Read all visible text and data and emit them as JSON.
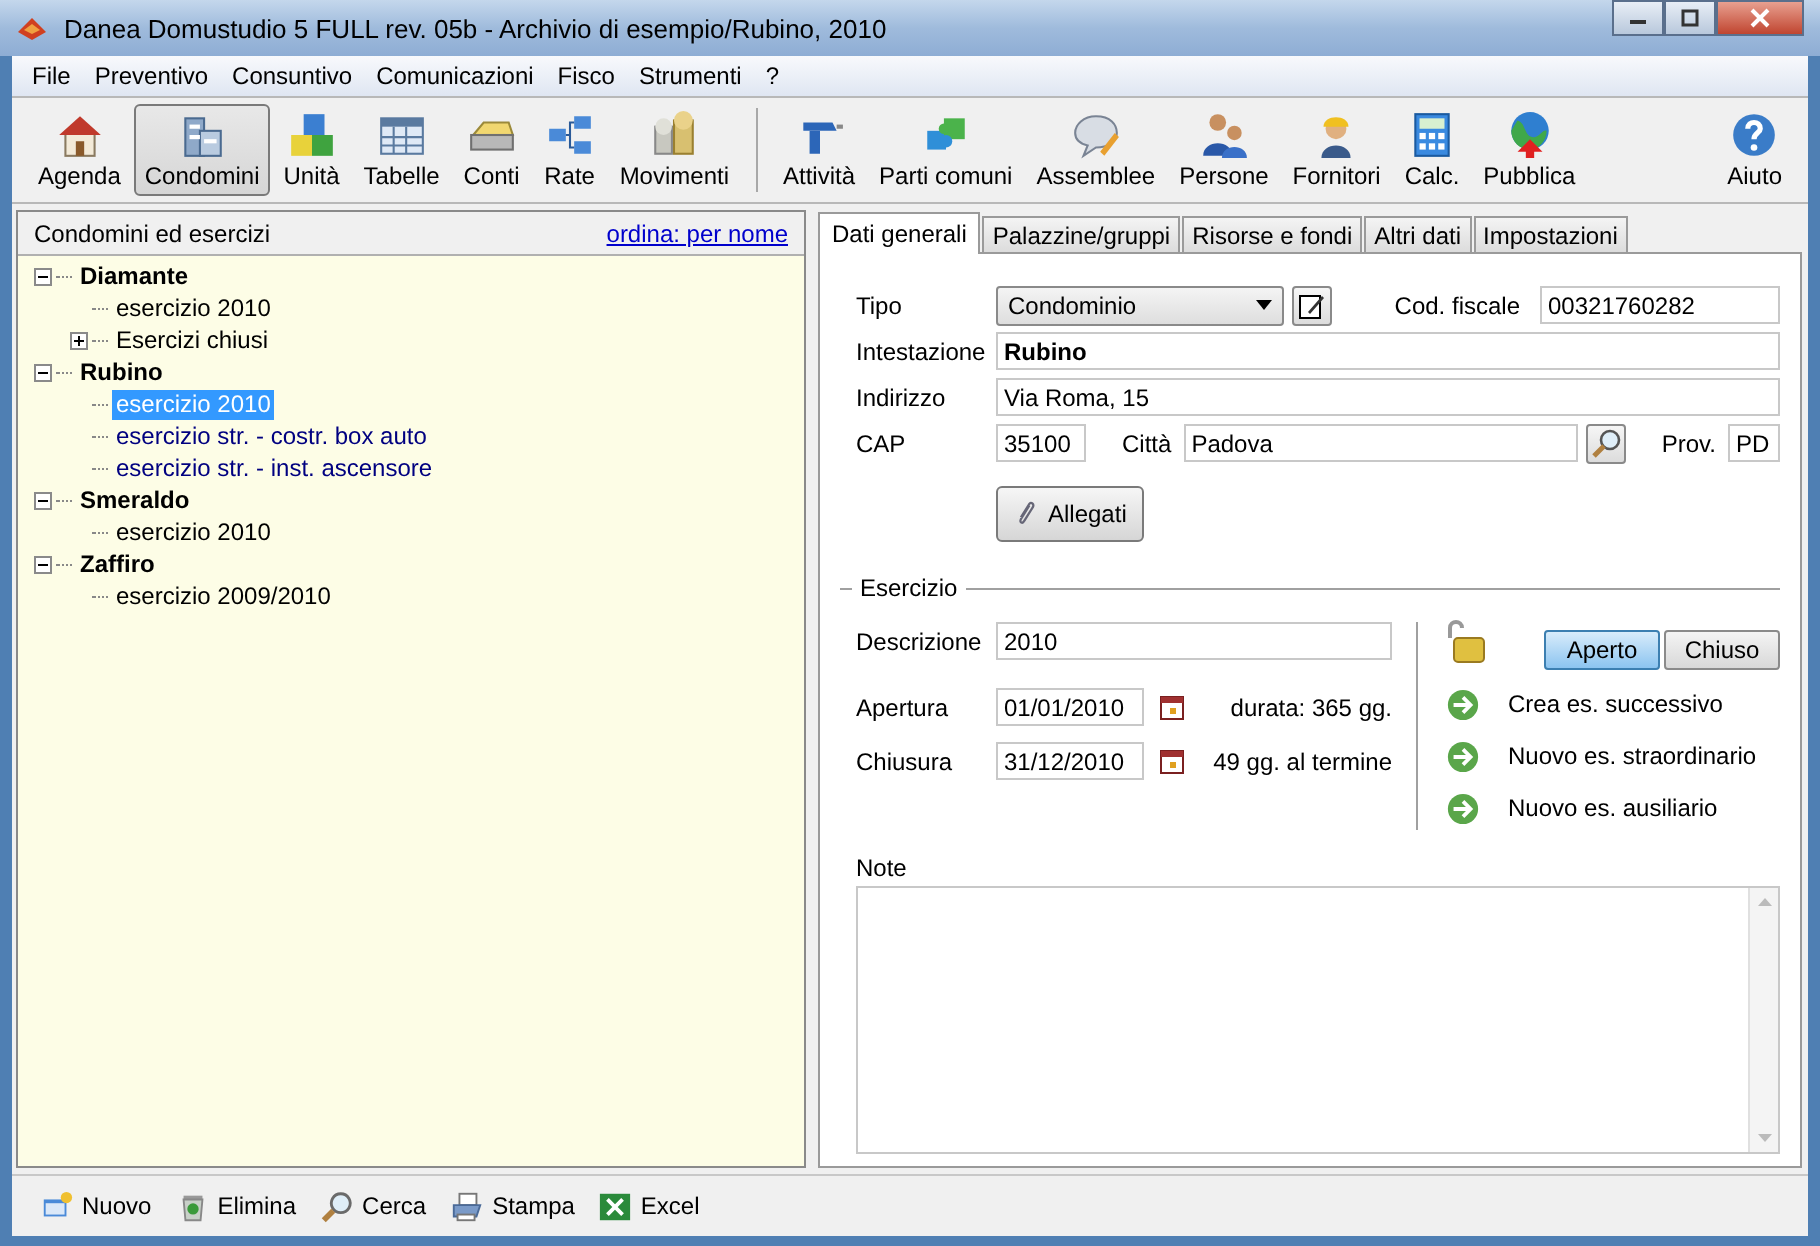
{
  "window": {
    "title": "Danea Domustudio 5 FULL rev. 05b - Archivio di esempio/Rubino, 2010"
  },
  "menu": [
    "File",
    "Preventivo",
    "Consuntivo",
    "Comunicazioni",
    "Fisco",
    "Strumenti",
    "?"
  ],
  "toolbar": {
    "left": [
      {
        "label": "Agenda",
        "selected": false
      },
      {
        "label": "Condomini",
        "selected": true
      },
      {
        "label": "Unità",
        "selected": false
      },
      {
        "label": "Tabelle",
        "selected": false
      },
      {
        "label": "Conti",
        "selected": false
      },
      {
        "label": "Rate",
        "selected": false
      },
      {
        "label": "Movimenti",
        "selected": false
      }
    ],
    "right": [
      {
        "label": "Attività",
        "selected": false
      },
      {
        "label": "Parti comuni",
        "selected": false
      },
      {
        "label": "Assemblee",
        "selected": false
      },
      {
        "label": "Persone",
        "selected": false
      },
      {
        "label": "Fornitori",
        "selected": false
      },
      {
        "label": "Calc.",
        "selected": false
      },
      {
        "label": "Pubblica",
        "selected": false
      }
    ],
    "help": {
      "label": "Aiuto",
      "selected": false
    }
  },
  "tree": {
    "title": "Condomini ed esercizi",
    "sort_link": "ordina: per nome",
    "items": [
      {
        "label": "Diamante",
        "expanded": true,
        "children": [
          {
            "label": "esercizio 2010",
            "selected": false,
            "color": "#000000"
          },
          {
            "label": "Esercizi chiusi",
            "expanded": false,
            "selected": false,
            "color": "#000000"
          }
        ]
      },
      {
        "label": "Rubino",
        "expanded": true,
        "children": [
          {
            "label": "esercizio 2010",
            "selected": true
          },
          {
            "label": "esercizio str. - costr. box auto",
            "selected": false,
            "color": "#000080"
          },
          {
            "label": "esercizio str. - inst. ascensore",
            "selected": false,
            "color": "#000080"
          }
        ]
      },
      {
        "label": "Smeraldo",
        "expanded": true,
        "children": [
          {
            "label": "esercizio 2010",
            "selected": false,
            "color": "#000000"
          }
        ]
      },
      {
        "label": "Zaffiro",
        "expanded": true,
        "children": [
          {
            "label": "esercizio 2009/2010",
            "selected": false,
            "color": "#000000"
          }
        ]
      }
    ]
  },
  "tabs": [
    {
      "label": "Dati generali",
      "selected": true
    },
    {
      "label": "Palazzine/gruppi",
      "selected": false
    },
    {
      "label": "Risorse e fondi",
      "selected": false
    },
    {
      "label": "Altri dati",
      "selected": false
    },
    {
      "label": "Impostazioni",
      "selected": false
    }
  ],
  "general": {
    "tipo_label": "Tipo",
    "tipo_value": "Condominio",
    "codfisc_label": "Cod. fiscale",
    "codfisc_value": "00321760282",
    "intestazione_label": "Intestazione",
    "intestazione_value": "Rubino",
    "indirizzo_label": "Indirizzo",
    "indirizzo_value": "Via Roma, 15",
    "cap_label": "CAP",
    "cap_value": "35100",
    "citta_label": "Città",
    "citta_value": "Padova",
    "prov_label": "Prov.",
    "prov_value": "PD",
    "attachments_button": "Allegati"
  },
  "esercizio": {
    "title": "Esercizio",
    "descrizione_label": "Descrizione",
    "descrizione_value": "2010",
    "apertura_label": "Apertura",
    "apertura_value": "01/01/2010",
    "durata": "durata: 365 gg.",
    "chiusura_label": "Chiusura",
    "chiusura_value": "31/12/2010",
    "termine": "49 gg. al termine",
    "states": [
      {
        "label": "Aperto",
        "selected": true
      },
      {
        "label": "Chiuso",
        "selected": false
      }
    ],
    "actions": [
      "Crea es. successivo",
      "Nuovo es. straordinario",
      "Nuovo es. ausiliario"
    ]
  },
  "note": {
    "label": "Note"
  },
  "bottom_bar": [
    "Nuovo",
    "Elimina",
    "Cerca",
    "Stampa",
    "Excel"
  ]
}
